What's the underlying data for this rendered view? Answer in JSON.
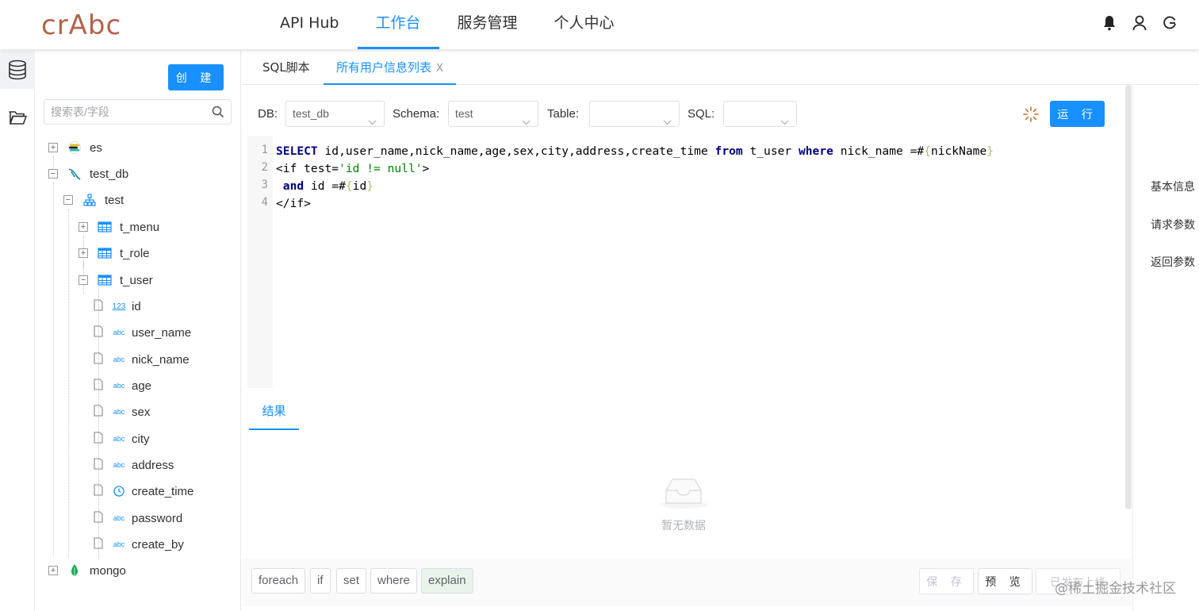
{
  "header": {
    "logo": "crAbc",
    "nav": [
      {
        "label": "API Hub",
        "active": false
      },
      {
        "label": "工作台",
        "active": true
      },
      {
        "label": "服务管理",
        "active": false
      },
      {
        "label": "个人中心",
        "active": false
      }
    ],
    "icons": [
      "bell-icon",
      "user-icon",
      "refresh-icon"
    ]
  },
  "rail": {
    "icons": [
      "database-icon",
      "folder-icon"
    ]
  },
  "tree_panel": {
    "create_label": "创 建",
    "search_placeholder": "搜索表/字段",
    "nodes": {
      "es": "es",
      "test_db": "test_db",
      "test": "test",
      "t_menu": "t_menu",
      "t_role": "t_role",
      "t_user": "t_user",
      "fields": [
        "id",
        "user_name",
        "nick_name",
        "age",
        "sex",
        "city",
        "address",
        "create_time",
        "password",
        "create_by"
      ],
      "mongo": "mongo"
    }
  },
  "tabs": [
    {
      "label": "SQL脚本",
      "active": false
    },
    {
      "label": "所有用户信息列表",
      "active": true,
      "close": "X"
    }
  ],
  "toolbar": {
    "db_label": "DB:",
    "db_value": "test_db",
    "schema_label": "Schema:",
    "schema_value": "test",
    "table_label": "Table:",
    "table_value": "",
    "sql_label": "SQL:",
    "sql_value": "",
    "run_label": "运 行"
  },
  "editor": {
    "line_numbers": [
      "1",
      "2",
      "3",
      "4"
    ],
    "lines": [
      "SELECT id,user_name,nick_name,age,sex,city,address,create_time from t_user where nick_name =#{nickName}",
      "<if test='id != null'>",
      " and id =#{id}",
      "</if>"
    ]
  },
  "results": {
    "tab_label": "结果",
    "empty_text": "暂无数据"
  },
  "bottom": {
    "chips": [
      "foreach",
      "if",
      "set",
      "where",
      "explain"
    ],
    "save_label": "保 存",
    "preview_label": "预 览",
    "publish_label": "已发布上线"
  },
  "right_panel": {
    "items": [
      "基本信息",
      "请求参数",
      "返回参数"
    ]
  },
  "watermark": "@稀土掘金技术社区",
  "colors": {
    "primary": "#1890ff",
    "logo": "#b3634a"
  }
}
